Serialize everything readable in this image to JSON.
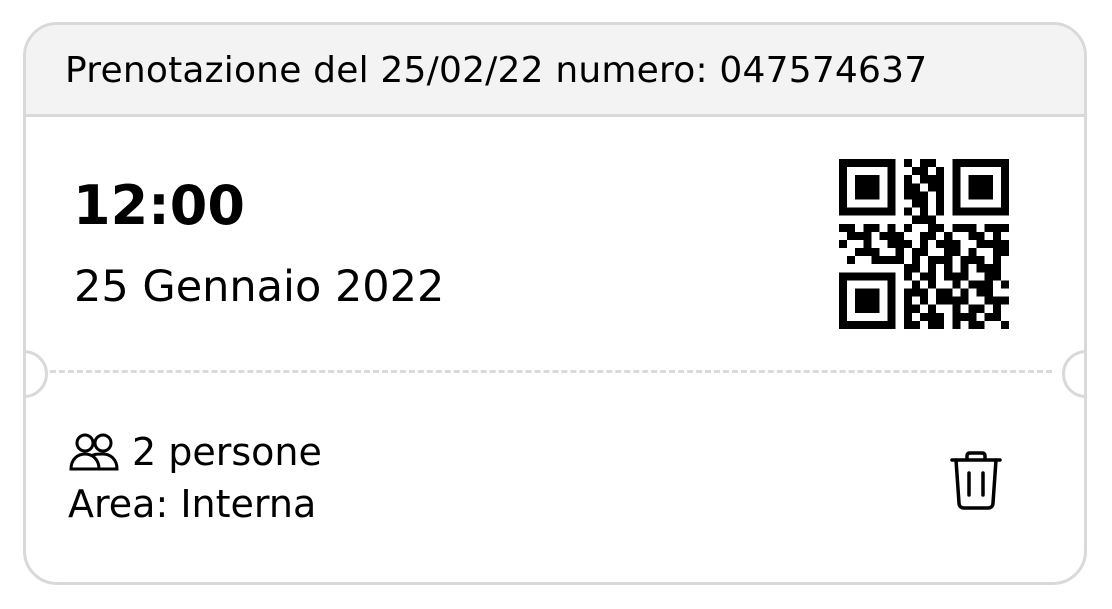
{
  "reservation": {
    "header_text": "Prenotazione del 25/02/22 numero: 047574637",
    "time": "12:00",
    "date": "25 Gennaio 2022",
    "people_text": "2 persone",
    "area_text": "Area: Interna"
  },
  "icons": {
    "people": "people-icon",
    "qr": "qr-code",
    "delete": "trash-icon"
  },
  "colors": {
    "border": "#d9d9d9",
    "header_bg": "#f3f3f3",
    "text": "#000000"
  }
}
